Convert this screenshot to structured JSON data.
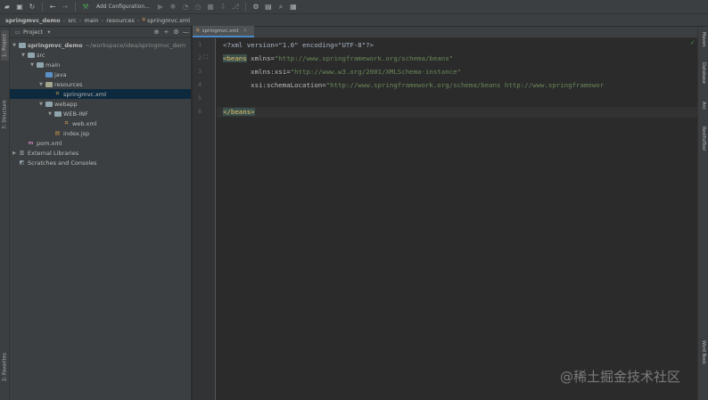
{
  "toolbar": {
    "icons": [
      "folder-open-icon",
      "save-icon",
      "sync-icon",
      "back-icon",
      "forward-icon",
      "build-icon",
      "run-icon",
      "debug-icon",
      "coverage-icon",
      "profile-icon",
      "stop-icon",
      "update-icon",
      "vcs-icon",
      "settings-icon",
      "structure-icon",
      "search-icon"
    ],
    "config_label": "Add Configuration..."
  },
  "breadcrumb": {
    "items": [
      "springmvc_demo",
      "src",
      "main",
      "resources",
      "springmvc.xml"
    ]
  },
  "left_strip": {
    "tabs": [
      "1: Project",
      "7: Structure",
      "2: Favorites"
    ]
  },
  "project_panel": {
    "title": "Project",
    "tree": [
      {
        "label": "springmvc_demo",
        "hint": "~/workspace/idea/springmvc_dem",
        "icon": "module-folder-icon",
        "arrow": "▼"
      },
      {
        "label": "src",
        "icon": "folder-icon",
        "arrow": "▼"
      },
      {
        "label": "main",
        "icon": "folder-icon",
        "arrow": "▼"
      },
      {
        "label": "java",
        "icon": "source-folder-icon",
        "arrow": ""
      },
      {
        "label": "resources",
        "icon": "resources-folder-icon",
        "arrow": "▼"
      },
      {
        "label": "springmvc.xml",
        "icon": "spring-xml-icon",
        "arrow": "",
        "selected": true
      },
      {
        "label": "webapp",
        "icon": "web-folder-icon",
        "arrow": "▼"
      },
      {
        "label": "WEB-INF",
        "icon": "folder-icon",
        "arrow": "▼"
      },
      {
        "label": "web.xml",
        "icon": "xml-file-icon",
        "arrow": ""
      },
      {
        "label": "index.jsp",
        "icon": "jsp-file-icon",
        "arrow": ""
      },
      {
        "label": "pom.xml",
        "icon": "maven-icon",
        "arrow": ""
      },
      {
        "label": "External Libraries",
        "icon": "library-icon",
        "arrow": "▶"
      },
      {
        "label": "Scratches and Consoles",
        "icon": "scratches-icon",
        "arrow": ""
      }
    ]
  },
  "editor": {
    "tab_label": "springmvc.xml",
    "line_numbers": [
      "1",
      "2",
      "3",
      "4",
      "5",
      "6"
    ],
    "lines": [
      {
        "p": [
          [
            "",
            "<?xml version=\"1.0\" encoding=\"UTF-8\"?>"
          ]
        ]
      },
      {
        "p": [
          [
            "tagbg",
            "<beans"
          ],
          [
            "attr",
            " xmlns="
          ],
          [
            "val",
            "\"http://www.springframework.org/schema/beans\""
          ]
        ]
      },
      {
        "p": [
          [
            "attr",
            "       xmlns:xsi="
          ],
          [
            "val",
            "\"http://www.w3.org/2001/XMLSchema-instance\""
          ]
        ]
      },
      {
        "p": [
          [
            "attr",
            "       xsi:schemaLocation="
          ],
          [
            "val",
            "\"http://www.springframework.org/schema/beans http://www.springframewor"
          ]
        ]
      },
      {
        "p": []
      },
      {
        "p": [
          [
            "tagbg",
            "</beans>"
          ]
        ]
      }
    ]
  },
  "right_strip": {
    "tabs": [
      "Maven",
      "Database",
      "Ant",
      "RestfulTool",
      "Word Book"
    ]
  },
  "watermark": "@稀土掘金技术社区"
}
